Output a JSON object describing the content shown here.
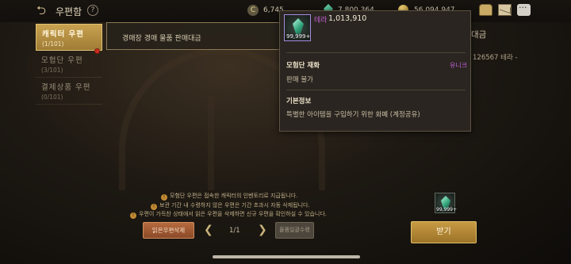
{
  "header": {
    "title": "우편함",
    "currencies": [
      {
        "icon": "silver-coin-icon",
        "value": "6,745"
      },
      {
        "icon": "gem-icon",
        "value": "7,800,364"
      },
      {
        "icon": "gold-coin-icon",
        "value": "56,094,947"
      }
    ],
    "coin_symbol": "C"
  },
  "tabs": [
    {
      "label": "캐릭터 우편",
      "count": "(1/101)",
      "active": true
    },
    {
      "label": "모험단 우편",
      "count": "(3/101)"
    },
    {
      "label": "결제상품 우편",
      "count": "(0/101)"
    }
  ],
  "mail_list": [
    {
      "title": "경매장 경매 물품 판매대금"
    }
  ],
  "detail": {
    "title": "대금",
    "description": "126567 테라 -"
  },
  "notices": [
    "모험단 우편은 접속한 캐릭터의 인벤토리로 지급됩니다.",
    "보관 기간 내 수령하지 않은 우편은 기간 초과시 자동 삭제됩니다.",
    "우편이 가득찬 상태에서 읽은 우편을 삭제하면 신규 우편을 확인하실 수 있습니다."
  ],
  "notice_symbol": "!",
  "controls": {
    "delete_read_label": "읽은우편삭제",
    "page": "1/1",
    "claim_all_label": "물품일괄수령",
    "receive_label": "받기",
    "prev_arrow": "❮",
    "next_arrow": "❯"
  },
  "attachment": {
    "icon": "tera-crystal-icon",
    "quantity": "99,999+"
  },
  "tooltip": {
    "item_name": "테라",
    "amount": "1,013,910",
    "quantity": "99,999+",
    "section1_label": "모험단 재화",
    "rarity": "유니크",
    "section1_value": "판매 불가",
    "section2_label": "기본정보",
    "section2_value": "특별한 아이템을 구입하기 위한 화폐 (계정공유)"
  },
  "colors": {
    "accent_gold": "#c9a250",
    "rarity_unique": "#c25fd6",
    "delete_button": "#b56a3e"
  }
}
